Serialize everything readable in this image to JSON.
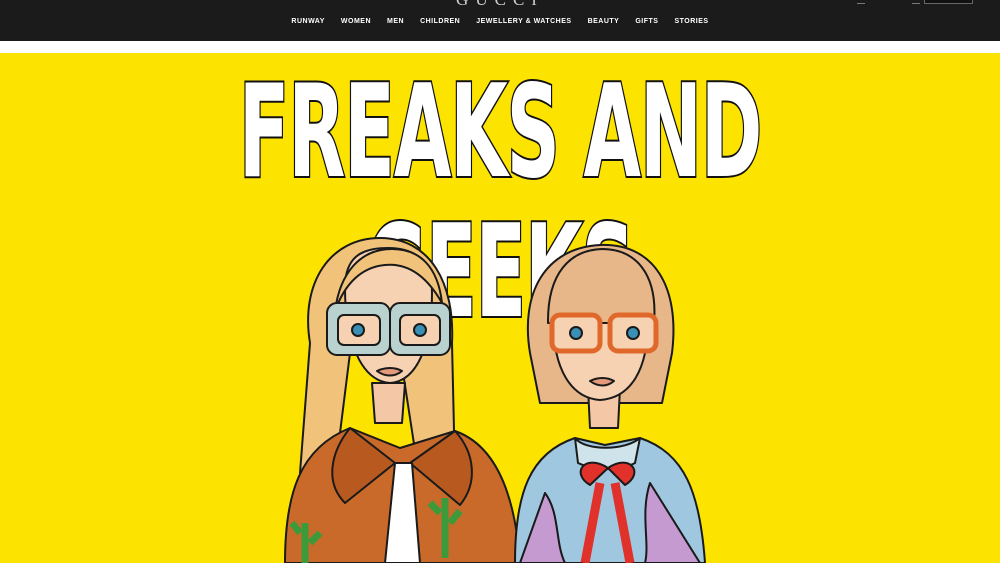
{
  "header": {
    "brand": "GUCCI",
    "nav": [
      "RUNWAY",
      "WOMEN",
      "MEN",
      "CHILDREN",
      "JEWELLERY & WATCHES",
      "BEAUTY",
      "GIFTS",
      "STORIES"
    ]
  },
  "hero": {
    "headline": "FREAKS AND GEEKS",
    "background": "#fde400"
  },
  "colors": {
    "topbar": "#1b1b1b",
    "hero_bg": "#fde400"
  },
  "icons": [
    "search-icon"
  ]
}
